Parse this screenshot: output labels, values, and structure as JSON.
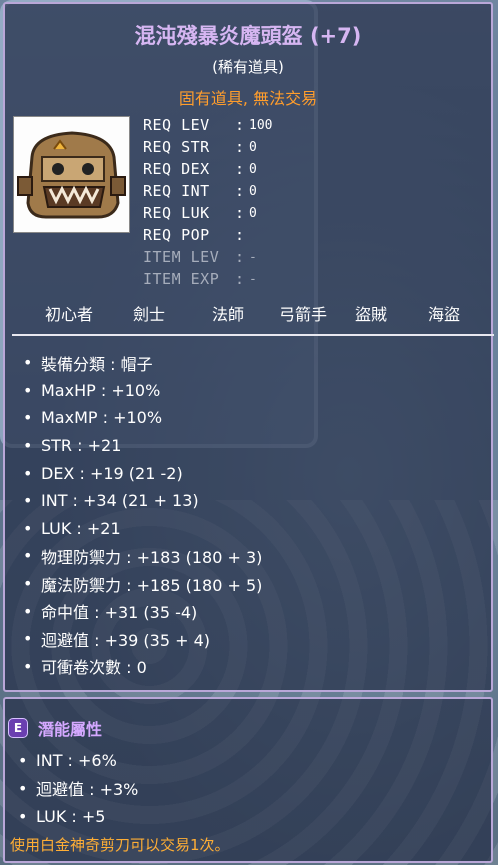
{
  "item": {
    "name": "混沌殘暴炎魔頭盔 (+7)",
    "rarity": "(稀有道具)",
    "trade_note": "固有道具, 無法交易"
  },
  "requirements": [
    {
      "key": "REQ LEV",
      "sep": ":",
      "value": "100",
      "dim": false
    },
    {
      "key": "REQ STR",
      "sep": ":",
      "value": "0",
      "dim": false
    },
    {
      "key": "REQ DEX",
      "sep": ":",
      "value": "0",
      "dim": false
    },
    {
      "key": "REQ INT",
      "sep": ":",
      "value": "0",
      "dim": false
    },
    {
      "key": "REQ LUK",
      "sep": ":",
      "value": "0",
      "dim": false
    },
    {
      "key": "REQ POP",
      "sep": ":",
      "value": "",
      "dim": false
    },
    {
      "key": "ITEM LEV",
      "sep": ":",
      "value": "-",
      "dim": true
    },
    {
      "key": "ITEM EXP",
      "sep": ":",
      "value": "-",
      "dim": true
    }
  ],
  "jobs": [
    "初心者",
    "劍士",
    "法師",
    "弓箭手",
    "盜賊",
    "海盜"
  ],
  "stats": [
    "裝備分類 : 帽子",
    "MaxHP : +10%",
    "MaxMP : +10%",
    "STR : +21",
    "DEX : +19 (21 -2)",
    "INT : +34 (21 + 13)",
    "LUK : +21",
    "物理防禦力 : +183 (180 + 3)",
    "魔法防禦力 : +185 (180 + 5)",
    "命中值 : +31 (35 -4)",
    "迴避值 : +39 (35 + 4)",
    "可衝卷次數 : 0"
  ],
  "potential": {
    "badge": "E",
    "title": "潛能屬性",
    "lines": [
      "INT : +6%",
      "迴避值 : +3%",
      "LUK : +5"
    ]
  },
  "scissors_note": "使用白金神奇剪刀可以交易1次。",
  "colors": {
    "title": "#d6b6f2",
    "trade_note": "#ff9d2c",
    "potential_title": "#d4a8ff",
    "scissors_note": "#ffae35",
    "border": "#b9a7d8"
  }
}
